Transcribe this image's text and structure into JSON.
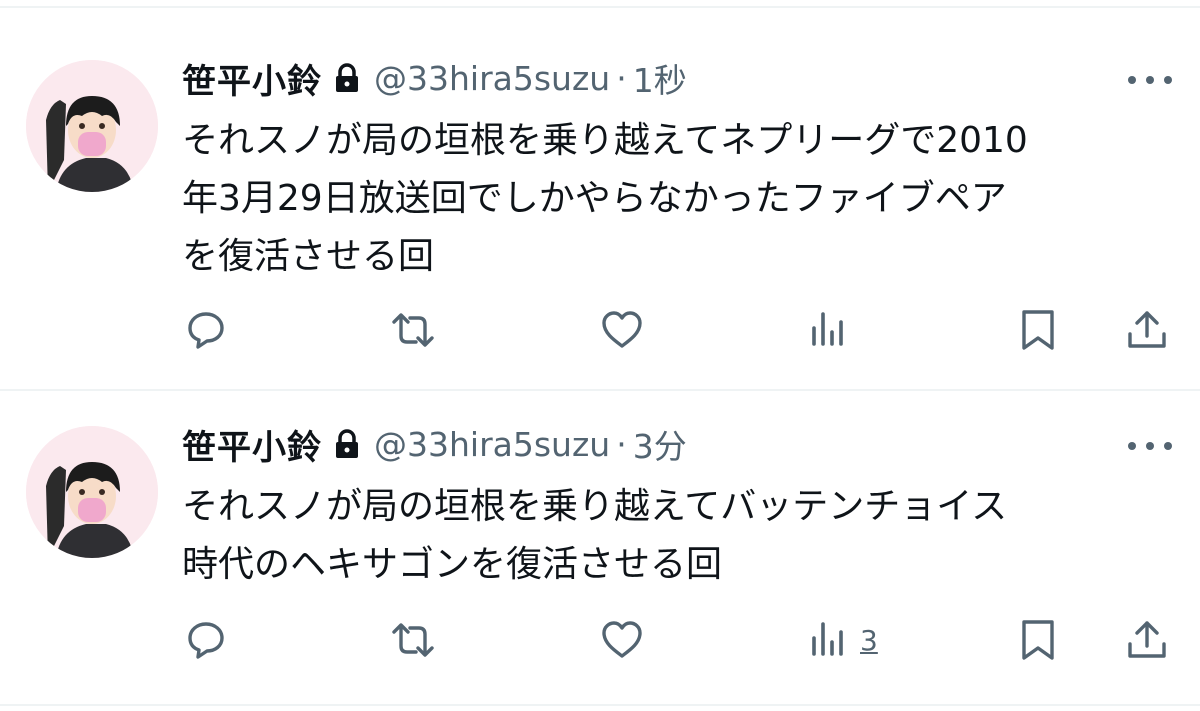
{
  "colors": {
    "text": "#0f1419",
    "secondary": "#536471",
    "divider": "#eff3f4"
  },
  "tweets": [
    {
      "name": "笹平小鈴",
      "handle": "@33hira5suzu",
      "separator": "·",
      "time": "1秒",
      "text_lines": [
        "それスノが局の垣根を乗り越えてネプリーグで2010",
        "年3月29日放送回でしかやらなかったファイブペア",
        "を復活させる回"
      ],
      "icons": [
        "lock-icon",
        "more-icon",
        "reply-icon",
        "retweet-icon",
        "like-icon",
        "views-icon",
        "bookmark-icon",
        "share-icon"
      ],
      "views_count": ""
    },
    {
      "name": "笹平小鈴",
      "handle": "@33hira5suzu",
      "separator": "·",
      "time": "3分",
      "text_lines": [
        "それスノが局の垣根を乗り越えてバッテンチョイス",
        "時代のヘキサゴンを復活させる回"
      ],
      "icons": [
        "lock-icon",
        "more-icon",
        "reply-icon",
        "retweet-icon",
        "like-icon",
        "views-icon",
        "bookmark-icon",
        "share-icon"
      ],
      "views_count": "3"
    }
  ]
}
